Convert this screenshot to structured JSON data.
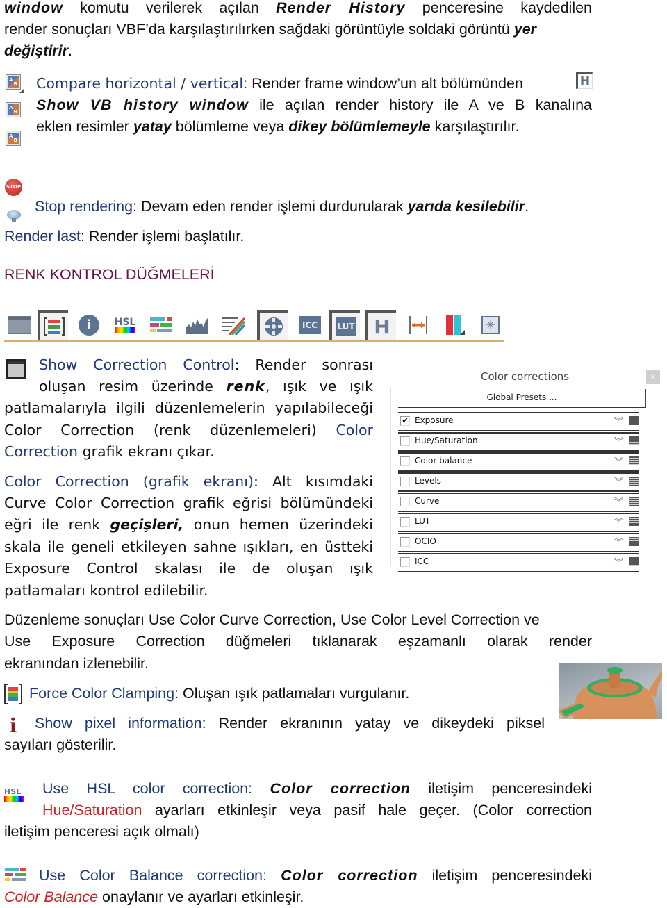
{
  "intro": {
    "line1": {
      "b1": "window",
      "t1": " komutu verilerek açılan ",
      "b2": "Render History",
      "t2": " penceresine kaydedilen"
    },
    "line2": {
      "t1": "render sonuçları VBF’da karşılaştırılırken sağdaki görüntüyle soldaki görüntü ",
      "b1": "yer"
    },
    "line3": {
      "b1": "değiştirir",
      "t1": "."
    }
  },
  "compare": {
    "label": "Compare horizontal / vertical",
    "line1_rest": ": Render frame window’un alt bölümünden",
    "line2_bold": "Show VB history window",
    "line2_rest": " ile açılan render history ile A ve B kanalına",
    "line3_t1": "eklen resimler ",
    "line3_b1": "yatay",
    "line3_t2": " bölümleme veya ",
    "line3_b2": "dikey bölümlemeyle",
    "line3_t3": " karşılaştırılır.",
    "icon_letters": [
      "A",
      "B"
    ],
    "h_icon": "H"
  },
  "stop": {
    "icon_text": "STOP",
    "label": "Stop rendering",
    "rest": ": Devam eden render işlemi durdurularak ",
    "bold": "yarıda kesilebilir",
    "end": "."
  },
  "render_last": {
    "label": "Render last",
    "rest": ": Render işlemi başlatılır."
  },
  "heading": "RENK KONTROL DÜĞMELERİ",
  "toolbar": {
    "hsl": "HSL",
    "icc": "ICC",
    "lut": "LUT",
    "h": "H",
    "accent": "#d8b06a"
  },
  "show_cc": {
    "label": "Show Correction Control",
    "l1_rest": ": Render sonrası",
    "l2_t1": "oluşan resim üzerinde ",
    "l2_b1": "renk",
    "l2_t2": ", ışık ve ışık",
    "l3": "patlamalarıyla ilgili düzenlemelerin yapılabileceği",
    "l4_t1": "Color Correction (renk düzenlemeleri) ",
    "l4_blue": "Color",
    "l5_blue": "Correction",
    "l5_rest": " grafik ekranı çıkar."
  },
  "cc_graph": {
    "label": "Color Correction (grafik ekranı)",
    "l1_rest": ": Alt kısımdaki",
    "l2": "Curve Color Correction grafik eğrisi bölümündeki",
    "l3_t1": "eğri ile renk ",
    "l3_b1": "geçişleri,",
    "l3_t2": " onun hemen üzerindeki",
    "l4": "skala ile geneli etkileyen sahne ışıkları, en üstteki",
    "l5": "Exposure Control skalası ile de oluşan ışık",
    "l6": "patlamaları kontrol edilebilir."
  },
  "panel": {
    "title": "Color corrections",
    "close": "×",
    "presets": "Global Presets ...",
    "items": [
      {
        "label": "Exposure",
        "checked": true
      },
      {
        "label": "Hue/Saturation",
        "checked": false
      },
      {
        "label": "Color balance",
        "checked": false
      },
      {
        "label": "Levels",
        "checked": false
      },
      {
        "label": "Curve",
        "checked": false
      },
      {
        "label": "LUT",
        "checked": false
      },
      {
        "label": "OCIO",
        "checked": false
      },
      {
        "label": "ICC",
        "checked": false
      }
    ],
    "check_glyph": "✔",
    "chevron_glyph": "︾"
  },
  "results": {
    "l1": "Düzenleme sonuçları Use Color Curve Correction, Use Color Level Correction ve",
    "l2": "Use Exposure Correction düğmeleri tıklanarak eşzamanlı olarak render",
    "l3": "ekranından izlenebilir."
  },
  "force_clamp": {
    "label": "Force Color Clamping",
    "rest": ": Oluşan ışık patlamaları vurgulanır."
  },
  "pixel_info": {
    "icon": "i",
    "label": "Show pixel information",
    "rest": ": Render ekranının yatay ve dikeydeki piksel",
    "l2": "sayıları gösterilir."
  },
  "hsl": {
    "icon": "HSL",
    "label": "Use HSL color correction:",
    "bold": "Color correction",
    "rest": " iletişim penceresindeki",
    "l2_red": "Hue/Saturation",
    "l2_rest": " ayarları etkinleşir veya pasif hale geçer. (Color correction",
    "l3": "iletişim penceresi açık olmalı)"
  },
  "balance": {
    "label": "Use Color Balance correction:",
    "bold": "Color correction",
    "rest": " iletişim penceresindeki",
    "l2_red": "Color Balance",
    "l2_rest": " onaylanır ve ayarları etkinleşir."
  }
}
